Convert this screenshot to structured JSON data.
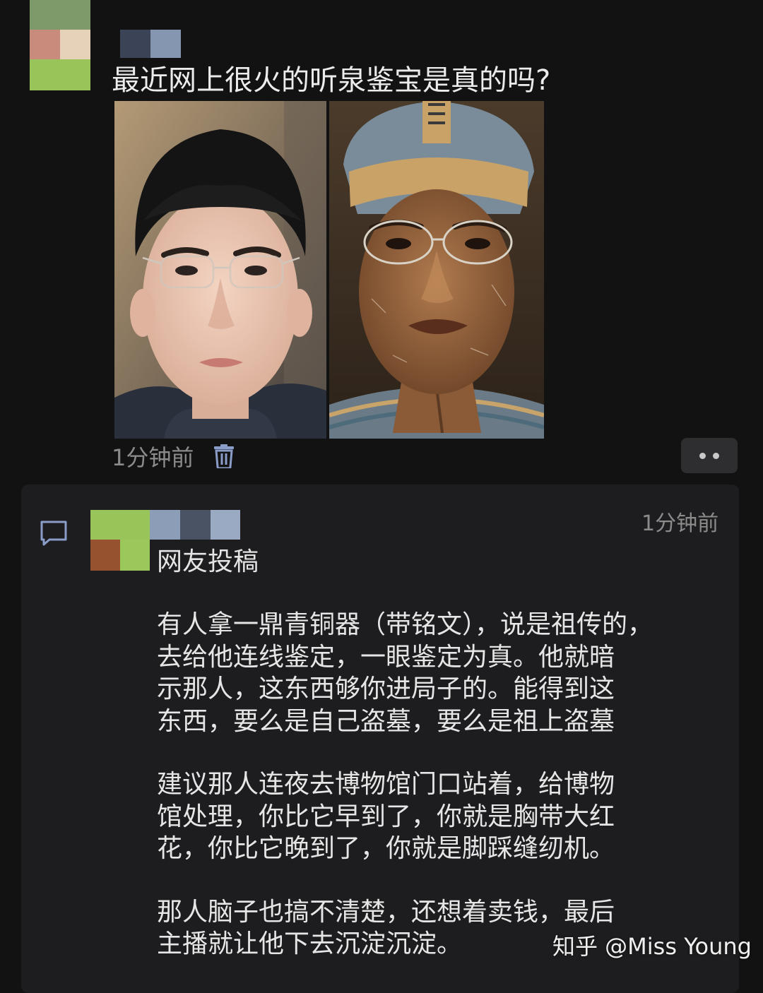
{
  "post": {
    "title": "最近网上很火的听泉鉴宝是真的吗?",
    "time": "1分钟前",
    "icons": [
      "trash-icon",
      "more-icon"
    ]
  },
  "comment": {
    "time": "1分钟前",
    "author": "网友投稿",
    "paragraphs": [
      [
        "有人拿一鼎青铜器（带铭文），说是祖传的，",
        "去给他连线鉴定，一眼鉴定为真。他就暗",
        "示那人，这东西够你进局子的。能得到这",
        "东西，要么是自己盗墓，要么是祖上盗墓"
      ],
      [
        "建议那人连夜去博物馆门口站着，给博物",
        "馆处理，你比它早到了，你就是胸带大红",
        "花，你比它晚到了，你就是脚踩缝纫机。"
      ],
      [
        "那人脑子也搞不清楚，还想着卖钱，最后",
        "主播就让他下去沉淀沉淀。"
      ]
    ]
  },
  "watermark": "知乎 @Miss Young",
  "colors": {
    "background": "#121212",
    "card": "#1d1d1f",
    "text": "#e6e6e6",
    "muted": "#8b8b8b",
    "accent_icon": "#8a9cc8"
  }
}
